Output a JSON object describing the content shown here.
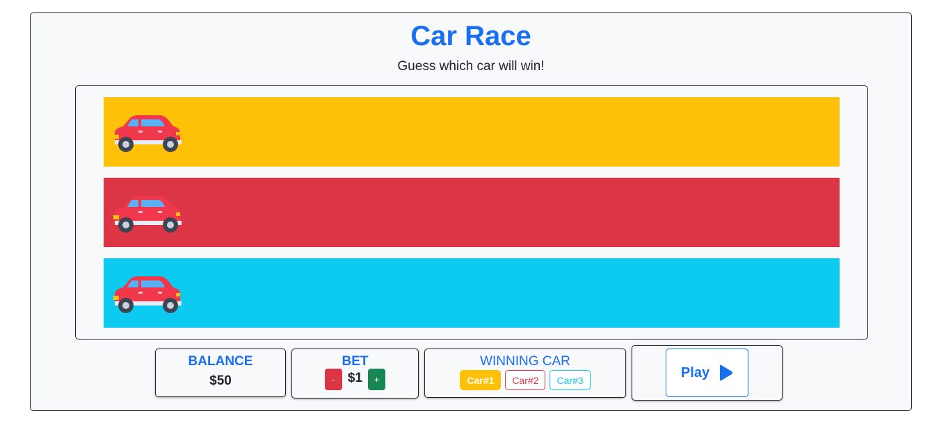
{
  "game": {
    "title": "Car Race",
    "subtitle": "Guess which car will win!"
  },
  "lanes": [
    {
      "color": "#ffc107",
      "car_icon": "red-car-icon"
    },
    {
      "color": "#dc3545",
      "car_icon": "red-car-icon"
    },
    {
      "color": "#0dcaf0",
      "car_icon": "red-car-icon"
    }
  ],
  "balance": {
    "label": "BALANCE",
    "value": "$50"
  },
  "bet": {
    "label": "BET",
    "decrement_label": "-",
    "value": "$1",
    "increment_label": "+"
  },
  "winning_car": {
    "label": "WINNING CAR",
    "options": [
      "Car#1",
      "Car#2",
      "Car#3"
    ],
    "selected": "Car#1"
  },
  "play": {
    "label": "Play",
    "icon": "play-icon"
  }
}
